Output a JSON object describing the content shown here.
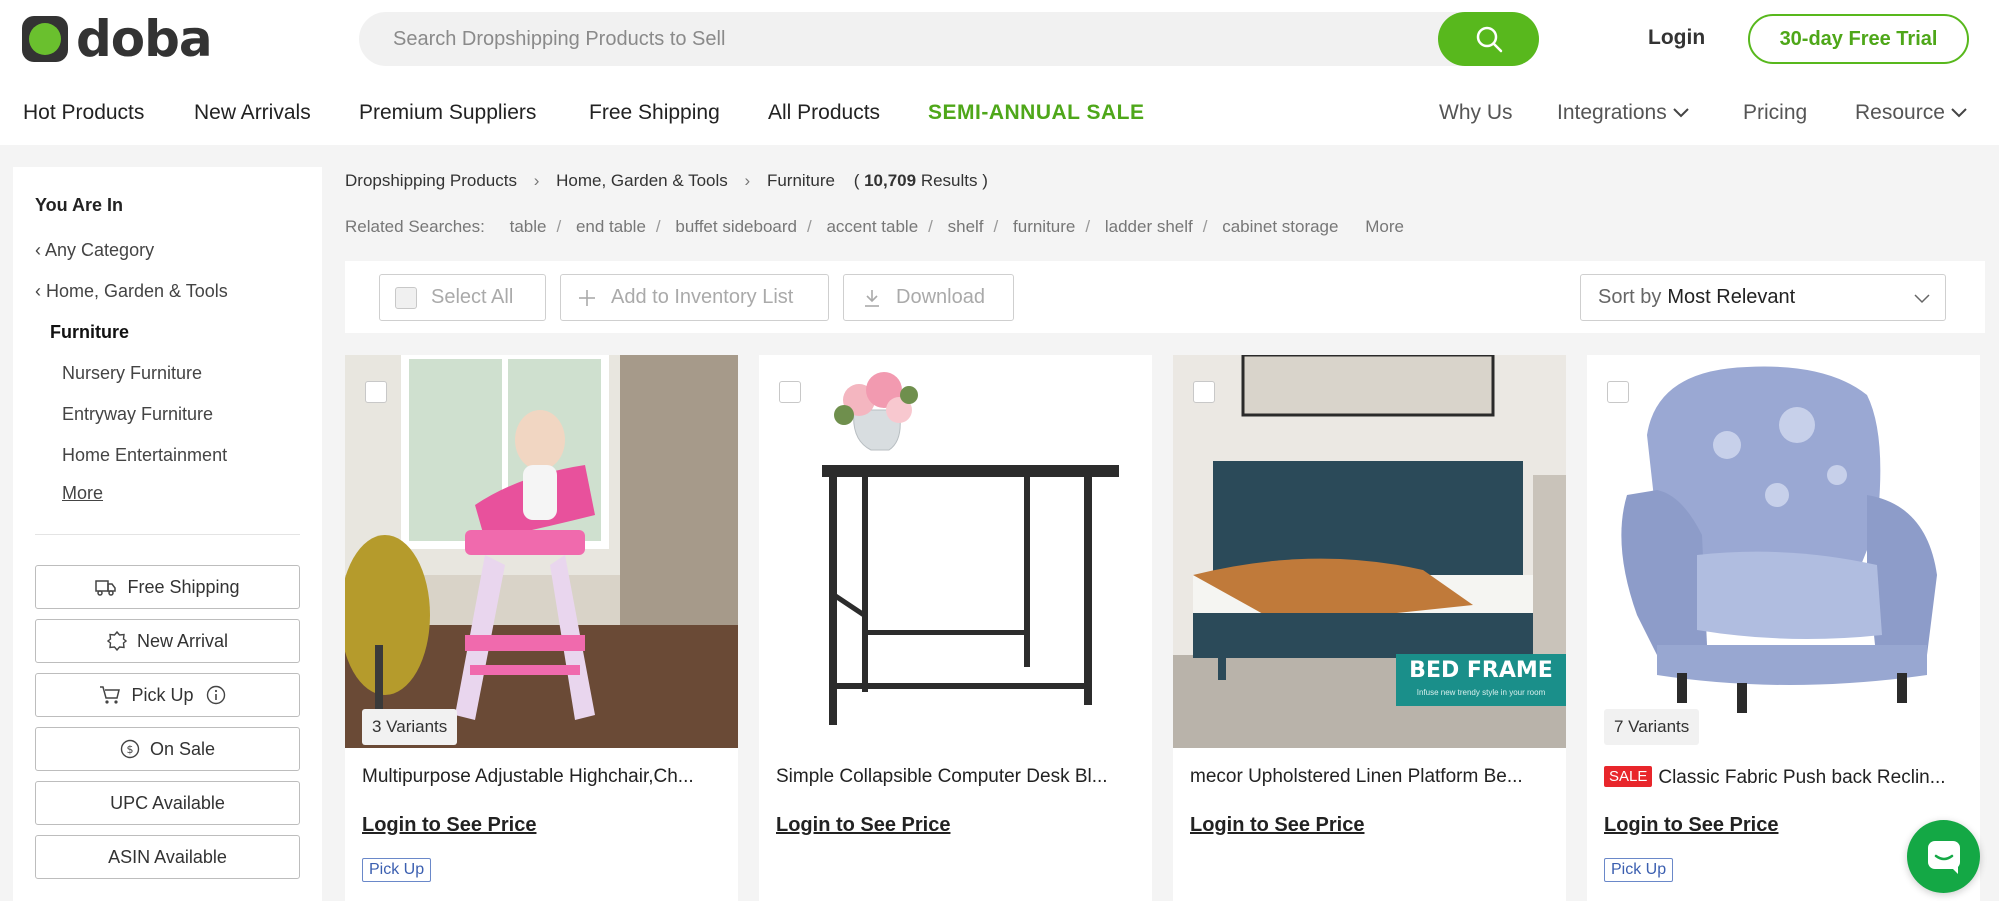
{
  "brand": {
    "logo_text": "doba",
    "accent": "#58b81d"
  },
  "header": {
    "search_placeholder": "Search Dropshipping Products to Sell",
    "search_icon": "search-icon",
    "login_label": "Login",
    "trial_label": "30-day Free Trial"
  },
  "nav": {
    "left": [
      "Hot Products",
      "New Arrivals",
      "Premium Suppliers",
      "Free Shipping",
      "All Products"
    ],
    "sale": "SEMI-ANNUAL SALE",
    "right": [
      "Why Us",
      "Integrations",
      "Pricing",
      "Resource"
    ]
  },
  "sidebar": {
    "title": "You Are In",
    "parents": [
      "Any Category",
      "Home, Garden & Tools"
    ],
    "current": "Furniture",
    "children": [
      "Nursery Furniture",
      "Entryway Furniture",
      "Home Entertainment"
    ],
    "more": "More",
    "filters": [
      "Free Shipping",
      "New Arrival",
      "Pick Up",
      "On Sale",
      "UPC Available",
      "ASIN Available"
    ]
  },
  "breadcrumb": {
    "items": [
      "Dropshipping Products",
      "Home, Garden & Tools",
      "Furniture"
    ],
    "results_count": "10,709",
    "results_label": "Results"
  },
  "related": {
    "label": "Related Searches:",
    "terms": [
      "table",
      "end table",
      "buffet sideboard",
      "accent table",
      "shelf",
      "furniture",
      "ladder shelf",
      "cabinet storage"
    ],
    "more": "More"
  },
  "toolbar": {
    "select_all": "Select All",
    "add_inventory": "Add to Inventory List",
    "download": "Download",
    "sort_label": "Sort by",
    "sort_value": "Most Relevant"
  },
  "products": [
    {
      "title": "Multipurpose Adjustable Highchair,Ch...",
      "variants": "3 Variants",
      "price": "Login to See Price",
      "tag": "Pick Up",
      "sale": ""
    },
    {
      "title": "Simple Collapsible Computer Desk Bl...",
      "variants": "",
      "price": "Login to See Price",
      "tag": "",
      "sale": ""
    },
    {
      "title": "mecor Upholstered Linen Platform Be...",
      "variants": "",
      "price": "Login to See Price",
      "tag": "",
      "sale": "",
      "banner": "BED FRAME",
      "banner_sub": "Infuse new trendy style in your room"
    },
    {
      "title": "Classic Fabric Push back Reclin...",
      "variants": "7 Variants",
      "price": "Login to See Price",
      "tag": "Pick Up",
      "sale": "SALE"
    }
  ]
}
